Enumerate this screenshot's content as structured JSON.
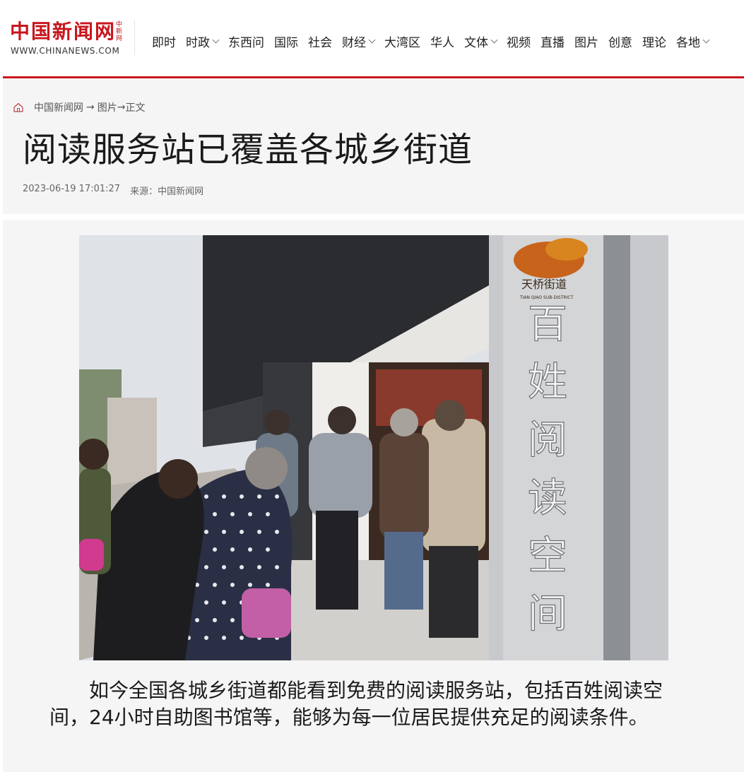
{
  "site": {
    "logo_cn": "中国新闻网",
    "logo_vertical": "中新网",
    "logo_en": "WWW.CHINANEWS.COM"
  },
  "nav": [
    {
      "label": "即时",
      "dropdown": false
    },
    {
      "label": "时政",
      "dropdown": true
    },
    {
      "label": "东西问",
      "dropdown": false
    },
    {
      "label": "国际",
      "dropdown": false
    },
    {
      "label": "社会",
      "dropdown": false
    },
    {
      "label": "财经",
      "dropdown": true
    },
    {
      "label": "大湾区",
      "dropdown": false
    },
    {
      "label": "华人",
      "dropdown": false
    },
    {
      "label": "文体",
      "dropdown": true
    },
    {
      "label": "视频",
      "dropdown": false
    },
    {
      "label": "直播",
      "dropdown": false
    },
    {
      "label": "图片",
      "dropdown": false
    },
    {
      "label": "创意",
      "dropdown": false
    },
    {
      "label": "理论",
      "dropdown": false
    },
    {
      "label": "各地",
      "dropdown": true
    }
  ],
  "breadcrumb": {
    "home": "中国新闻网",
    "sep1": "→",
    "section": "图片",
    "sep2": "→",
    "current": "正文"
  },
  "article": {
    "title": "阅读服务站已覆盖各城乡街道",
    "datetime": "2023-06-19 17:01:27",
    "source_label": "来源：中国新闻网",
    "caption": "如今全国各城乡街道都能看到免费的阅读服务站，包括百姓阅读空间，24小时自助图书馆等，能够为每一位居民提供充足的阅读条件。"
  },
  "photo": {
    "sign_text": "百姓阅读空间",
    "sign_logo": "天桥街道",
    "sign_logo_en": "TIAN QIAO SUB-DISTRICT"
  },
  "colors": {
    "brand_red": "#c8161d",
    "panel_bg": "#f5f5f5"
  }
}
